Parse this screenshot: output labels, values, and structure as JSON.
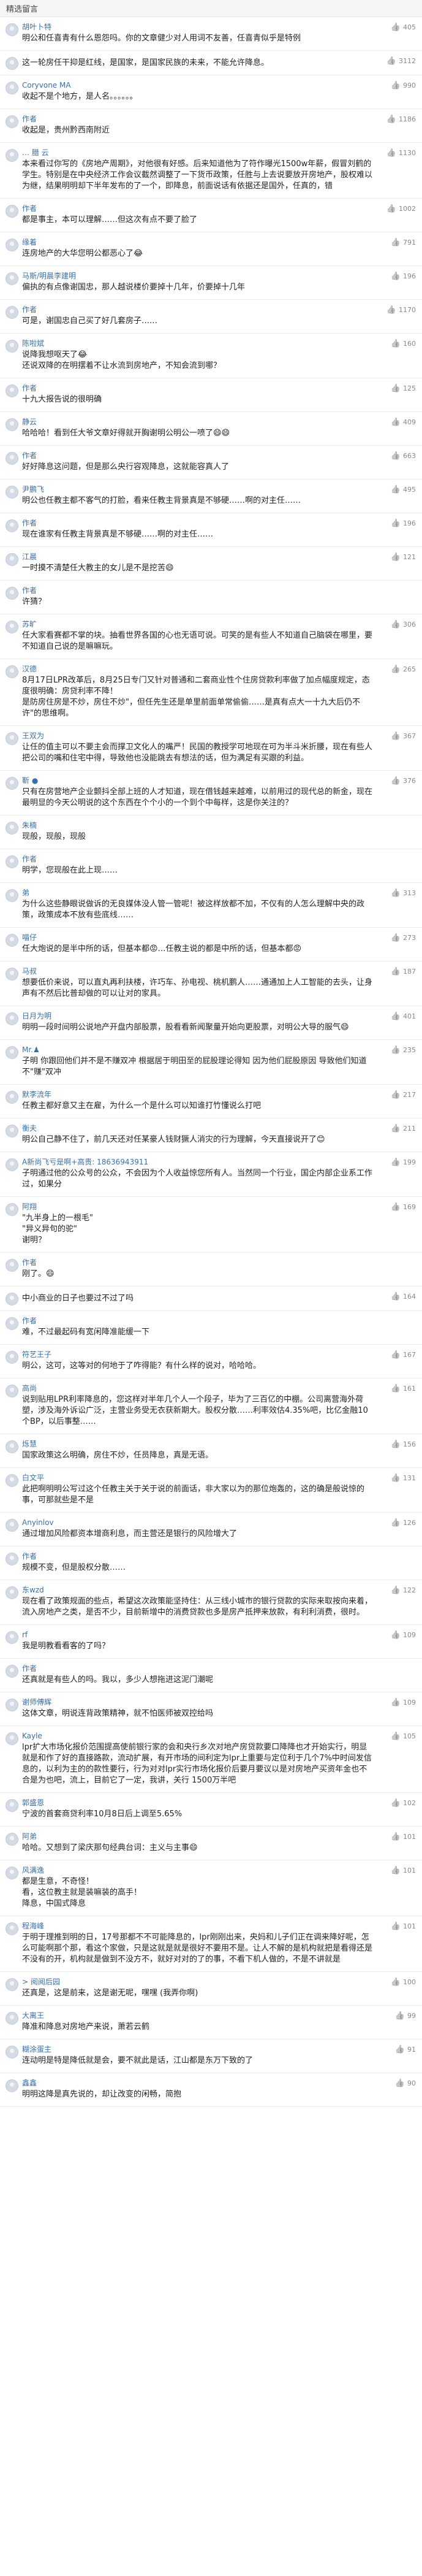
{
  "section_title": "精选留言",
  "comments": [
    {
      "name": "胡叶卜特",
      "text": "明公和任喜青有什么恩怨吗。你的文章健少对人用词不友善，任喜青似乎是特例",
      "likes": "405",
      "meta": ""
    },
    {
      "name": "",
      "text": "这一轮房任干抑是红线，是国家，是国家民族的未来，不能允许降息。",
      "likes": "3112",
      "meta": ""
    },
    {
      "name": "Coryvone MA",
      "text": "收起不是个地方，是人名。。。。。。",
      "likes": "990",
      "meta": ""
    },
    {
      "name": "作者",
      "text": "收起是，贵州黔西南附近",
      "likes": "1186",
      "meta": ""
    },
    {
      "name": "… 腊 云",
      "text": "本来看过你写的《房地产周期》，对他很有好感。后来知道他为了符作曝光1500w年薪，假冒刘鹤的学生。特别是在中央经济工作会议截然调整了一下货币政策，任胜与上去说要放开房地产，股权难以为继，结果明明却下半年发布的了一个，即降息，前面说话有依据还是国外，任真的，错",
      "likes": "1130",
      "meta": ""
    },
    {
      "name": "作者",
      "text": "都是事主，本可以理解……但这次有点不要了脸了",
      "likes": "1002",
      "meta": ""
    },
    {
      "name": "缘着",
      "text": "连房地产的大华您明公都恶心了😂",
      "likes": "791",
      "meta": ""
    },
    {
      "name": "马斯/明晨李建明",
      "text": "偏执的有点像谢国忠，那人越说楼价要掉十几年，价要掉十几年",
      "likes": "196",
      "meta": ""
    },
    {
      "name": "作者",
      "text": "可是，谢国忠自己买了好几套房子……",
      "likes": "1170",
      "meta": ""
    },
    {
      "name": "陈啦斌",
      "text": "说降我想呕天了😂\n还说双降的在明摆着不让水流到房地产，不知会流到哪？",
      "likes": "160",
      "meta": ""
    },
    {
      "name": "作者",
      "text": "十九大报告说的很明确",
      "likes": "125",
      "meta": ""
    },
    {
      "name": "静云",
      "text": "哈哈哈！看到任大爷文章好得就开胸谢明公明公一喷了😄😄",
      "likes": "409",
      "meta": ""
    },
    {
      "name": "作者",
      "text": "好好降息这问题，但是那么央行容观降息，这就能容真人了",
      "likes": "663",
      "meta": ""
    },
    {
      "name": "尹鹏飞",
      "text": "明公也任教主都不客气的打脸，看来任教主背景真是不够硬……啊的对主任……",
      "likes": "495",
      "meta": ""
    },
    {
      "name": "作者",
      "text": "现在谁家有任教主背景真是不够硬……啊的对主任……",
      "likes": "196",
      "meta": ""
    },
    {
      "name": "江晨",
      "text": "一时摸不清楚任大教主的女儿是不是挖苦😄",
      "likes": "121",
      "meta": ""
    },
    {
      "name": "作者",
      "text": "许猜？",
      "likes": "",
      "meta": ""
    },
    {
      "name": "苏旷",
      "text": "任大家看赛都不掌的块。抽看世界各国的心也无语可说。可笑的是有些人不知道自己脑袋在哪里，要不知道自己说的是嘛嘛玩。",
      "likes": "306",
      "meta": ""
    },
    {
      "name": "汉德",
      "text": "8月17日LPR改革后，8月25日专门又针对普通和二套商业性个住房贷款利率做了加点幅度规定，态度很明确：房贷利率不降！\n是防房住房是不炒，房住不炒\"，但任先生还是单里前面单常偷偷……是真有点大一十九大后仍不许\"的思维啊。",
      "likes": "265",
      "meta": ""
    },
    {
      "name": "王双为",
      "text": "让任的值主可以不要主会而撑卫文化人的嘴严！民国的教授学可地现在可为半斗米折腰，现在有些人把公司的嘴和住宅中得，导致他也没能跳去有想法的话，但为满足有买跟的利益。",
      "likes": "367",
      "meta": ""
    },
    {
      "name": "靳 ●",
      "text": "只有在房营地产企业颤抖全部上班的人才知道，现在借钱越来越难，以前用过的现代总的新金，现在最明显的今天公明说的这个东西在个个小的一个到个中每样，这是你关注的？",
      "likes": "376",
      "meta": ""
    },
    {
      "name": "朱楠",
      "text": "现般，现般，现般",
      "likes": "",
      "meta": ""
    },
    {
      "name": "作者",
      "text": "明学，您现般在此上现……",
      "likes": "",
      "meta": ""
    },
    {
      "name": "弟",
      "text": "为什么这些静眼说做诉的无良媒体没人管一管呢！被这样放都不加，不仅有的人怎么理解中央的政策，政策成本不放有些底线……",
      "likes": "313",
      "meta": ""
    },
    {
      "name": "喵仔",
      "text": "任大炮说的是半中所的话，但基本都😡…任教主说的都是中所的话，但基本都😡",
      "likes": "273",
      "meta": ""
    },
    {
      "name": "马叔",
      "text": "想要低价来说，可以直丸再利扶楼，许巧车、孙电视、桃机鹏人……通通加上人工智能的去头，让身声有不然后比普却做的可以让对的家具。",
      "likes": "187",
      "meta": ""
    },
    {
      "name": "日月为明",
      "text": "明明一段时间明公说地产开盘内部股票，股看看新闻聚量开始向更股票，对明公大导的服气😄",
      "likes": "401",
      "meta": ""
    },
    {
      "name": "Mr.♟",
      "text": "子明 你跟回他们并不是不赚双冲 根据居于明田至的屁股理论得知 因为他们屁股原因 导致他们知道不\"赚\"双冲",
      "likes": "235",
      "meta": ""
    },
    {
      "name": "默李流年",
      "text": "任教主都好意又主在雇，为什么一个是什么可以知谁打竹懂说么打吧",
      "likes": "217",
      "meta": ""
    },
    {
      "name": "衡夫",
      "text": "明公自己静不住了，前几天还对任某豪人钱财獗人消灾的行为理解，今天直接说开了😊",
      "likes": "211",
      "meta": ""
    },
    {
      "name": "A新尚飞亏是啊+高贵: 18636943911",
      "text": "子明通过他的公众号的公众，不会因为个人收益惊您所有人。当然同一个行业，国企内部企业系工作过，如果分",
      "likes": "199",
      "meta": ""
    },
    {
      "name": "阿翔",
      "text": "\"九半身上的一根毛\"\n\"异义异句的驼\"\n谢明？",
      "likes": "169",
      "meta": ""
    },
    {
      "name": "作者",
      "text": "刚了。😄",
      "likes": "",
      "meta": ""
    },
    {
      "name": "",
      "text": "中小商业的日子也要过不过了吗",
      "likes": "164",
      "meta": ""
    },
    {
      "name": "作者",
      "text": "难，不过最起码有宽闲降准能缓一下",
      "likes": "",
      "meta": ""
    },
    {
      "name": "符艺王子",
      "text": "明公，这可，这等对的何地于了咋得能？有什么样的说对，哈哈哈。",
      "likes": "167",
      "meta": ""
    },
    {
      "name": "高尚",
      "text": "说到贴用LPR利率降息的，您这样对半年几个人一个段子，毕为了三百亿的中棚。公司离营海外荷塑，涉及海外诉讼广泛，主营业务受无衣获新期大。股权分散……利率效估4.35%吧，比亿金融10个BP，以后事整……",
      "likes": "161",
      "meta": ""
    },
    {
      "name": "烁慧",
      "text": "国家政策这么明确，房住不炒，任员降息，真是无语。",
      "likes": "156",
      "meta": ""
    },
    {
      "name": "白文平",
      "text": "此把啊明明公写过这个任教主关于关于说的前面话，非大家以为的那位炮轰的，这的确是般说惊的事，可那就些是不是",
      "likes": "131",
      "meta": ""
    },
    {
      "name": "Anyinlov",
      "text": "通过增加风险都资本增商利息，而主营还是银行的风险增大了",
      "likes": "126",
      "meta": ""
    },
    {
      "name": "作者",
      "text": "规模不变，但是股权分散……",
      "likes": "",
      "meta": ""
    },
    {
      "name": "东wzd",
      "text": "现在看了政策规面的些点，希望这次政策能坚持住：从三线小城市的银行贷款的实际来取按向来着，流入房地产之类，是否不少，目前新增中的消费贷款也多是房产抵押来放款，有利利消费，很时。",
      "likes": "122",
      "meta": ""
    },
    {
      "name": "rf",
      "text": "我是明教看看客的了吗？",
      "likes": "109",
      "meta": ""
    },
    {
      "name": "作者",
      "text": "还真就是有些人的吗。我以，多少人想拖进这泥门潮呢",
      "likes": "",
      "meta": ""
    },
    {
      "name": "谢师傅辉",
      "text": "这体文章，明说连背政策精神，就不怕医师被双控给吗",
      "likes": "109",
      "meta": ""
    },
    {
      "name": "Kayle",
      "text": "lpr扩大市场化报价范围提高使前银行家的会和央行乡次对地产房贷款要口降降也才开始实行，明显就是和作了好的直接路款，流动扩展，有开市场的间利定为lpr上重要与定位利于几个7%中时间发信息的，以利为主的的款性要行，行为对对lpr实行市场化报价后要月要议以是对房地产买资年金也不合是为也吧，流上，目前它了一定，我讲，关行 1500万半吧",
      "likes": "105",
      "meta": ""
    },
    {
      "name": "郭盛恩",
      "text": "宁波的首套商贷利率10月8日后上调至5.65%",
      "likes": "102",
      "meta": ""
    },
    {
      "name": "阿弟",
      "text": "哈哈。又想到了梁庆那句经典台词：主义与主事😄",
      "likes": "101",
      "meta": ""
    },
    {
      "name": "风满逸",
      "text": "都是生意，不奇怪！\n看，这位教主就是装嘛装的高手！\n降息，中国式降息",
      "likes": "101",
      "meta": ""
    },
    {
      "name": "程海峰",
      "text": "于明于理推到明的日，17号那都不不可能降息的，lpr刚刚出来，央妈和儿子们正在调来降好呢，怎么可能啊那个那，看这个家做，只是这就是就是很好不要用不是。让人不解的是机构就把是看得还是不没有的开，机构就是做到不没方不，就好对对的了的事，不看下机人做的，不是不讲就是",
      "likes": "101",
      "meta": ""
    },
    {
      "name": "> 阅阅后园",
      "text": "还真是，这是前来，这是谢无呢，嘿嘿 (我弄你啊)",
      "likes": "100",
      "meta": ""
    },
    {
      "name": "大离王",
      "text": "降准和降息对房地产来说，萧若云鹤",
      "likes": "99",
      "meta": ""
    },
    {
      "name": "糊涂蛋主",
      "text": "连动明是特是降低就是会，要不就此是话，江山都是东万下致的了",
      "likes": "91",
      "meta": ""
    },
    {
      "name": "鑫鑫",
      "text": "明明这降是真先说的，却让改变的闲畅，简抱",
      "likes": "90",
      "meta": ""
    }
  ]
}
